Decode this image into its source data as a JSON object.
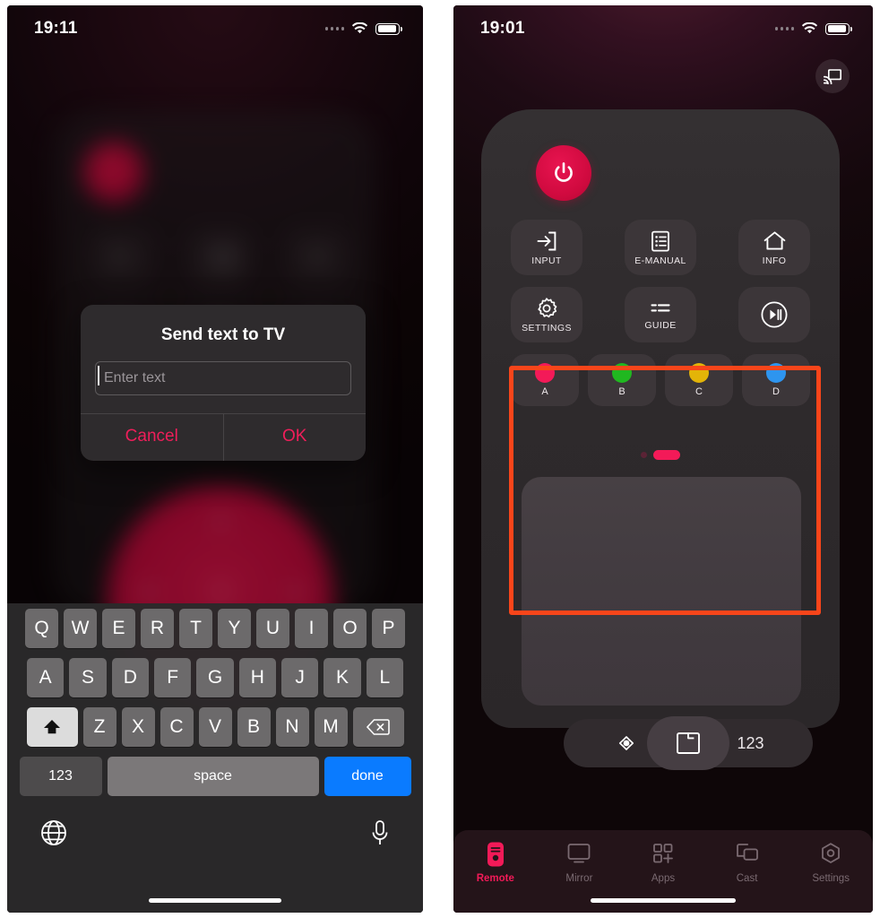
{
  "left_phone": {
    "status_bar": {
      "time": "19:11",
      "wifi_icon": "wifi-icon",
      "battery_icon": "battery-icon",
      "signal_dots": "signal-dots-icon"
    },
    "dialog": {
      "title": "Send text to TV",
      "input_value": "",
      "input_placeholder": "Enter text",
      "cancel_label": "Cancel",
      "ok_label": "OK",
      "accent_color": "#ef1e5a"
    },
    "keyboard": {
      "row1": [
        "Q",
        "W",
        "E",
        "R",
        "T",
        "Y",
        "U",
        "I",
        "O",
        "P"
      ],
      "row2": [
        "A",
        "S",
        "D",
        "F",
        "G",
        "H",
        "J",
        "K",
        "L"
      ],
      "row3": [
        "Z",
        "X",
        "C",
        "V",
        "B",
        "N",
        "M"
      ],
      "shift_icon": "shift-arrow-icon",
      "delete_icon": "backspace-icon",
      "numbers_label": "123",
      "space_label": "space",
      "done_label": "done",
      "done_color": "#0a7bff",
      "globe_icon": "globe-icon",
      "mic_icon": "microphone-icon"
    }
  },
  "right_phone": {
    "status_bar": {
      "time": "19:01",
      "wifi_icon": "wifi-icon",
      "battery_icon": "battery-icon",
      "signal_dots": "signal-dots-icon"
    },
    "cast_button": {
      "icon": "cast-screen-icon"
    },
    "remote": {
      "power_icon": "power-icon",
      "power_color": "#d00a3f",
      "buttons_row1": [
        {
          "label": "INPUT",
          "icon": "input-arrow-icon"
        },
        {
          "label": "E-MANUAL",
          "icon": "document-list-icon"
        },
        {
          "label": "INFO",
          "icon": "home-icon"
        }
      ],
      "buttons_row2": [
        {
          "label": "SETTINGS",
          "icon": "gear-icon"
        },
        {
          "label": "GUIDE",
          "icon": "guide-lines-icon"
        },
        {
          "label": "",
          "icon": "play-pause-icon"
        }
      ],
      "color_buttons": [
        {
          "label": "A",
          "color": "#f31a58"
        },
        {
          "label": "B",
          "color": "#20b820"
        },
        {
          "label": "C",
          "color": "#e3b408"
        },
        {
          "label": "D",
          "color": "#2e95ef"
        }
      ],
      "pager": {
        "total": 2,
        "active_index": 1,
        "active_color": "#f31a58"
      },
      "touchpad": {
        "label": ""
      },
      "mode_bar": {
        "dpad_icon": "dpad-icon",
        "touchpad_icon": "touchpad-icon",
        "numbers_label": "123"
      }
    },
    "highlight": {
      "color": "#f8451a",
      "target": "touchpad"
    },
    "tabbar": {
      "active_index": 0,
      "active_color": "#f31a58",
      "items": [
        {
          "label": "Remote",
          "icon": "remote-icon"
        },
        {
          "label": "Mirror",
          "icon": "monitor-icon"
        },
        {
          "label": "Apps",
          "icon": "apps-grid-icon"
        },
        {
          "label": "Cast",
          "icon": "cast-icon"
        },
        {
          "label": "Settings",
          "icon": "settings-hex-icon"
        }
      ]
    }
  }
}
